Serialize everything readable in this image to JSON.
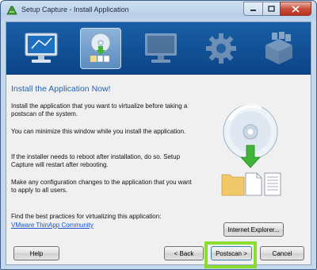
{
  "window": {
    "title": "Setup Capture - Install Application"
  },
  "steps": [
    {
      "icon": "monitor-icon",
      "active": false
    },
    {
      "icon": "install-disc-icon",
      "active": true
    },
    {
      "icon": "monitor-postscan-icon",
      "active": false
    },
    {
      "icon": "gear-icon",
      "active": false
    },
    {
      "icon": "package-icon",
      "active": false
    }
  ],
  "content": {
    "heading": "Install the Application Now!",
    "para1": "Install the application that you want to virtualize before taking a postscan of the system.",
    "para2": "You can minimize this window while you install the application.",
    "para3": "If the installer needs to reboot after installation, do so. Setup Capture will restart after rebooting.",
    "para4": "Make any configuration changes to the application that you want to apply to all users.",
    "best_practices": "Find the best practices for virtualizing this application:",
    "link": "VMware ThinApp Community"
  },
  "buttons": {
    "internet_explorer": "Internet Explorer...",
    "help": "Help",
    "back": "< Back",
    "postscan": "Postscan >",
    "cancel": "Cancel"
  },
  "colors": {
    "banner": "#0b4487",
    "heading": "#1b63b8",
    "highlight": "#8bdc2e",
    "link": "#1a56c8"
  }
}
